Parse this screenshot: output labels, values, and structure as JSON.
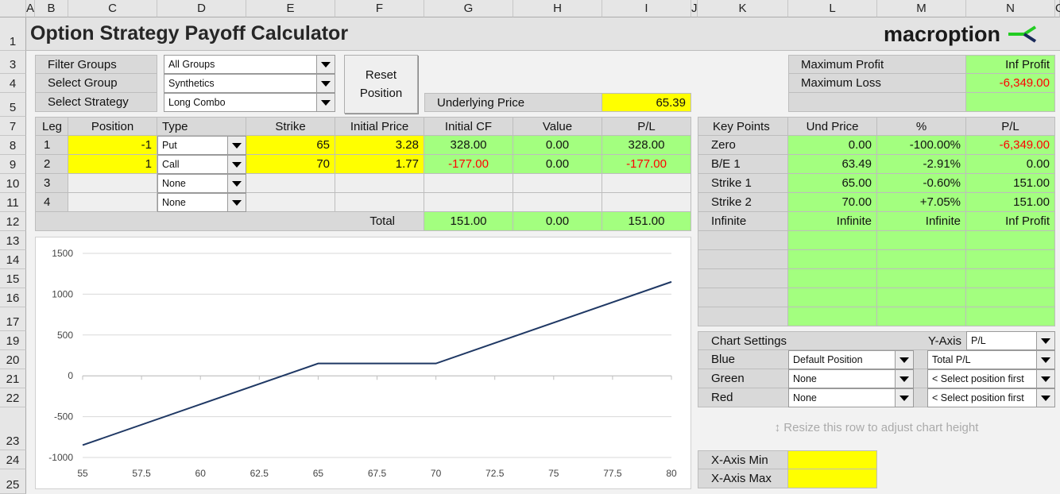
{
  "columns": [
    "A",
    "B",
    "C",
    "D",
    "E",
    "F",
    "G",
    "H",
    "I",
    "J",
    "K",
    "L",
    "M",
    "N",
    "O"
  ],
  "rows": [
    "1",
    "3",
    "4",
    "5",
    "7",
    "8",
    "9",
    "10",
    "11",
    "12",
    "13",
    "14",
    "15",
    "16",
    "17",
    "19",
    "20",
    "21",
    "22",
    "23",
    "24",
    "25"
  ],
  "title": "Option Strategy Payoff Calculator",
  "logo": {
    "text": "macroption",
    "colors": {
      "green": "#22cc22",
      "navy": "#1a2a5a"
    }
  },
  "filters": {
    "filter_groups_label": "Filter Groups",
    "filter_groups_value": "All Groups",
    "select_group_label": "Select Group",
    "select_group_value": "Synthetics",
    "select_strategy_label": "Select Strategy",
    "select_strategy_value": "Long Combo"
  },
  "reset_button": {
    "line1": "Reset",
    "line2": "Position"
  },
  "underlying": {
    "label": "Underlying Price",
    "value": "65.39"
  },
  "summary": {
    "max_profit_label": "Maximum Profit",
    "max_profit": "Inf Profit",
    "max_loss_label": "Maximum Loss",
    "max_loss": "-6,349.00"
  },
  "legs_table": {
    "headers": [
      "Leg",
      "Position",
      "Type",
      "Strike",
      "Initial Price",
      "Initial CF",
      "Value",
      "P/L"
    ],
    "rows": [
      {
        "leg": "1",
        "position": "-1",
        "type": "Put",
        "strike": "65",
        "price": "3.28",
        "cf": "328.00",
        "value": "0.00",
        "pl": "328.00"
      },
      {
        "leg": "2",
        "position": "1",
        "type": "Call",
        "strike": "70",
        "price": "1.77",
        "cf": "-177.00",
        "value": "0.00",
        "pl": "-177.00"
      },
      {
        "leg": "3",
        "position": "",
        "type": "None",
        "strike": "",
        "price": "",
        "cf": "",
        "value": "",
        "pl": ""
      },
      {
        "leg": "4",
        "position": "",
        "type": "None",
        "strike": "",
        "price": "",
        "cf": "",
        "value": "",
        "pl": ""
      }
    ],
    "total_label": "Total",
    "total_cf": "151.00",
    "total_value": "0.00",
    "total_pl": "151.00"
  },
  "key_points": {
    "headers": [
      "Key Points",
      "Und Price",
      "%",
      "P/L"
    ],
    "rows": [
      {
        "name": "Zero",
        "price": "0.00",
        "pct": "-100.00%",
        "pl": "-6,349.00"
      },
      {
        "name": "B/E 1",
        "price": "63.49",
        "pct": "-2.91%",
        "pl": "0.00"
      },
      {
        "name": "Strike 1",
        "price": "65.00",
        "pct": "-0.60%",
        "pl": "151.00"
      },
      {
        "name": "Strike 2",
        "price": "70.00",
        "pct": "+7.05%",
        "pl": "151.00"
      },
      {
        "name": "Infinite",
        "price": "Infinite",
        "pct": "Infinite",
        "pl": "Inf Profit"
      }
    ]
  },
  "chart_settings": {
    "title": "Chart Settings",
    "y_axis_label": "Y-Axis",
    "y_axis_value": "P/L",
    "rows": [
      {
        "label": "Blue",
        "position": "Default Position",
        "series": "Total P/L"
      },
      {
        "label": "Green",
        "position": "None",
        "series": "< Select position first"
      },
      {
        "label": "Red",
        "position": "None",
        "series": "< Select position first"
      }
    ],
    "resize_hint": "Resize this row to adjust chart height",
    "x_min_label": "X-Axis Min",
    "x_min": "",
    "x_max_label": "X-Axis Max",
    "x_max": ""
  },
  "chart_data": {
    "type": "line",
    "x": [
      55,
      65,
      70,
      80
    ],
    "series": [
      {
        "color": "#1f3864",
        "values": [
          -849,
          151,
          151,
          1151
        ]
      }
    ],
    "xlim": [
      55,
      80
    ],
    "ylim": [
      -1000,
      1500
    ],
    "x_ticks": [
      "55",
      "57.5",
      "60",
      "62.5",
      "65",
      "67.5",
      "70",
      "72.5",
      "75",
      "77.5",
      "80"
    ],
    "y_ticks": [
      "1500",
      "1000",
      "500",
      "0",
      "-500",
      "-1000"
    ],
    "grid": true
  }
}
